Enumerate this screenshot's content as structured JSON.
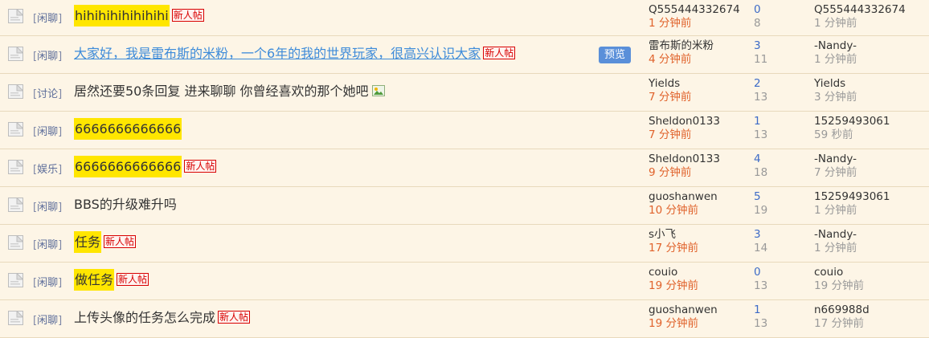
{
  "badge_label": "新人帖",
  "preview_label": "预览",
  "threads": [
    {
      "cat": "闲聊",
      "title": "hihihihihihihihi",
      "hl": true,
      "link": false,
      "badge": true,
      "img": false,
      "preview": false,
      "author": "Q555444332674",
      "time": "1 分钟前",
      "replies": "0",
      "views": "8",
      "last_user": "Q555444332674",
      "last_time": "1 分钟前"
    },
    {
      "cat": "闲聊",
      "title": "大家好，我是雷布斯的米粉，一个6年的我的世界玩家，很高兴认识大家",
      "hl": false,
      "link": true,
      "badge": true,
      "img": false,
      "preview": true,
      "author": "雷布斯的米粉",
      "time": "4 分钟前",
      "replies": "3",
      "views": "11",
      "last_user": "-Nandy-",
      "last_time": "1 分钟前"
    },
    {
      "cat": "讨论",
      "title": "居然还要50条回复 进来聊聊 你曾经喜欢的那个她吧",
      "hl": false,
      "link": false,
      "badge": false,
      "img": true,
      "preview": false,
      "author": "Yields",
      "time": "7 分钟前",
      "replies": "2",
      "views": "13",
      "last_user": "Yields",
      "last_time": "3 分钟前"
    },
    {
      "cat": "闲聊",
      "title": "6666666666666",
      "hl": true,
      "link": false,
      "badge": false,
      "img": false,
      "preview": false,
      "author": "Sheldon0133",
      "time": "7 分钟前",
      "replies": "1",
      "views": "13",
      "last_user": "15259493061",
      "last_time": "59 秒前"
    },
    {
      "cat": "娱乐",
      "title": "6666666666666",
      "hl": true,
      "link": false,
      "badge": true,
      "img": false,
      "preview": false,
      "author": "Sheldon0133",
      "time": "9 分钟前",
      "replies": "4",
      "views": "18",
      "last_user": "-Nandy-",
      "last_time": "7 分钟前"
    },
    {
      "cat": "闲聊",
      "title": "BBS的升级难升吗",
      "hl": false,
      "link": false,
      "badge": false,
      "img": false,
      "preview": false,
      "author": "guoshanwen",
      "time": "10 分钟前",
      "replies": "5",
      "views": "19",
      "last_user": "15259493061",
      "last_time": "1 分钟前"
    },
    {
      "cat": "闲聊",
      "title": "任务",
      "hl": true,
      "link": false,
      "badge": true,
      "img": false,
      "preview": false,
      "author": "s小飞",
      "time": "17 分钟前",
      "replies": "3",
      "views": "14",
      "last_user": "-Nandy-",
      "last_time": "1 分钟前"
    },
    {
      "cat": "闲聊",
      "title": "做任务",
      "hl": true,
      "link": false,
      "badge": true,
      "img": false,
      "preview": false,
      "author": "couio",
      "time": "19 分钟前",
      "replies": "0",
      "views": "13",
      "last_user": "couio",
      "last_time": "19 分钟前"
    },
    {
      "cat": "闲聊",
      "title": "上传头像的任务怎么完成",
      "hl": false,
      "link": false,
      "badge": true,
      "img": false,
      "preview": false,
      "author": "guoshanwen",
      "time": "19 分钟前",
      "replies": "1",
      "views": "13",
      "last_user": "n669988d",
      "last_time": "17 分钟前"
    }
  ]
}
